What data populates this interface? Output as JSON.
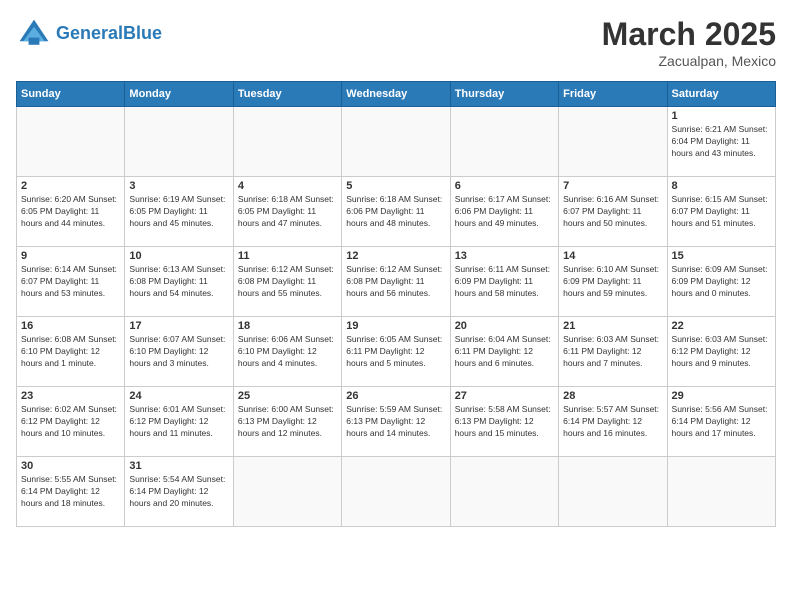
{
  "header": {
    "logo_general": "General",
    "logo_blue": "Blue",
    "month_title": "March 2025",
    "subtitle": "Zacualpan, Mexico"
  },
  "days_of_week": [
    "Sunday",
    "Monday",
    "Tuesday",
    "Wednesday",
    "Thursday",
    "Friday",
    "Saturday"
  ],
  "weeks": [
    [
      {
        "day": "",
        "info": ""
      },
      {
        "day": "",
        "info": ""
      },
      {
        "day": "",
        "info": ""
      },
      {
        "day": "",
        "info": ""
      },
      {
        "day": "",
        "info": ""
      },
      {
        "day": "",
        "info": ""
      },
      {
        "day": "1",
        "info": "Sunrise: 6:21 AM\nSunset: 6:04 PM\nDaylight: 11 hours and 43 minutes."
      }
    ],
    [
      {
        "day": "2",
        "info": "Sunrise: 6:20 AM\nSunset: 6:05 PM\nDaylight: 11 hours and 44 minutes."
      },
      {
        "day": "3",
        "info": "Sunrise: 6:19 AM\nSunset: 6:05 PM\nDaylight: 11 hours and 45 minutes."
      },
      {
        "day": "4",
        "info": "Sunrise: 6:18 AM\nSunset: 6:05 PM\nDaylight: 11 hours and 47 minutes."
      },
      {
        "day": "5",
        "info": "Sunrise: 6:18 AM\nSunset: 6:06 PM\nDaylight: 11 hours and 48 minutes."
      },
      {
        "day": "6",
        "info": "Sunrise: 6:17 AM\nSunset: 6:06 PM\nDaylight: 11 hours and 49 minutes."
      },
      {
        "day": "7",
        "info": "Sunrise: 6:16 AM\nSunset: 6:07 PM\nDaylight: 11 hours and 50 minutes."
      },
      {
        "day": "8",
        "info": "Sunrise: 6:15 AM\nSunset: 6:07 PM\nDaylight: 11 hours and 51 minutes."
      }
    ],
    [
      {
        "day": "9",
        "info": "Sunrise: 6:14 AM\nSunset: 6:07 PM\nDaylight: 11 hours and 53 minutes."
      },
      {
        "day": "10",
        "info": "Sunrise: 6:13 AM\nSunset: 6:08 PM\nDaylight: 11 hours and 54 minutes."
      },
      {
        "day": "11",
        "info": "Sunrise: 6:12 AM\nSunset: 6:08 PM\nDaylight: 11 hours and 55 minutes."
      },
      {
        "day": "12",
        "info": "Sunrise: 6:12 AM\nSunset: 6:08 PM\nDaylight: 11 hours and 56 minutes."
      },
      {
        "day": "13",
        "info": "Sunrise: 6:11 AM\nSunset: 6:09 PM\nDaylight: 11 hours and 58 minutes."
      },
      {
        "day": "14",
        "info": "Sunrise: 6:10 AM\nSunset: 6:09 PM\nDaylight: 11 hours and 59 minutes."
      },
      {
        "day": "15",
        "info": "Sunrise: 6:09 AM\nSunset: 6:09 PM\nDaylight: 12 hours and 0 minutes."
      }
    ],
    [
      {
        "day": "16",
        "info": "Sunrise: 6:08 AM\nSunset: 6:10 PM\nDaylight: 12 hours and 1 minute."
      },
      {
        "day": "17",
        "info": "Sunrise: 6:07 AM\nSunset: 6:10 PM\nDaylight: 12 hours and 3 minutes."
      },
      {
        "day": "18",
        "info": "Sunrise: 6:06 AM\nSunset: 6:10 PM\nDaylight: 12 hours and 4 minutes."
      },
      {
        "day": "19",
        "info": "Sunrise: 6:05 AM\nSunset: 6:11 PM\nDaylight: 12 hours and 5 minutes."
      },
      {
        "day": "20",
        "info": "Sunrise: 6:04 AM\nSunset: 6:11 PM\nDaylight: 12 hours and 6 minutes."
      },
      {
        "day": "21",
        "info": "Sunrise: 6:03 AM\nSunset: 6:11 PM\nDaylight: 12 hours and 7 minutes."
      },
      {
        "day": "22",
        "info": "Sunrise: 6:03 AM\nSunset: 6:12 PM\nDaylight: 12 hours and 9 minutes."
      }
    ],
    [
      {
        "day": "23",
        "info": "Sunrise: 6:02 AM\nSunset: 6:12 PM\nDaylight: 12 hours and 10 minutes."
      },
      {
        "day": "24",
        "info": "Sunrise: 6:01 AM\nSunset: 6:12 PM\nDaylight: 12 hours and 11 minutes."
      },
      {
        "day": "25",
        "info": "Sunrise: 6:00 AM\nSunset: 6:13 PM\nDaylight: 12 hours and 12 minutes."
      },
      {
        "day": "26",
        "info": "Sunrise: 5:59 AM\nSunset: 6:13 PM\nDaylight: 12 hours and 14 minutes."
      },
      {
        "day": "27",
        "info": "Sunrise: 5:58 AM\nSunset: 6:13 PM\nDaylight: 12 hours and 15 minutes."
      },
      {
        "day": "28",
        "info": "Sunrise: 5:57 AM\nSunset: 6:14 PM\nDaylight: 12 hours and 16 minutes."
      },
      {
        "day": "29",
        "info": "Sunrise: 5:56 AM\nSunset: 6:14 PM\nDaylight: 12 hours and 17 minutes."
      }
    ],
    [
      {
        "day": "30",
        "info": "Sunrise: 5:55 AM\nSunset: 6:14 PM\nDaylight: 12 hours and 18 minutes."
      },
      {
        "day": "31",
        "info": "Sunrise: 5:54 AM\nSunset: 6:14 PM\nDaylight: 12 hours and 20 minutes."
      },
      {
        "day": "",
        "info": ""
      },
      {
        "day": "",
        "info": ""
      },
      {
        "day": "",
        "info": ""
      },
      {
        "day": "",
        "info": ""
      },
      {
        "day": "",
        "info": ""
      }
    ]
  ]
}
